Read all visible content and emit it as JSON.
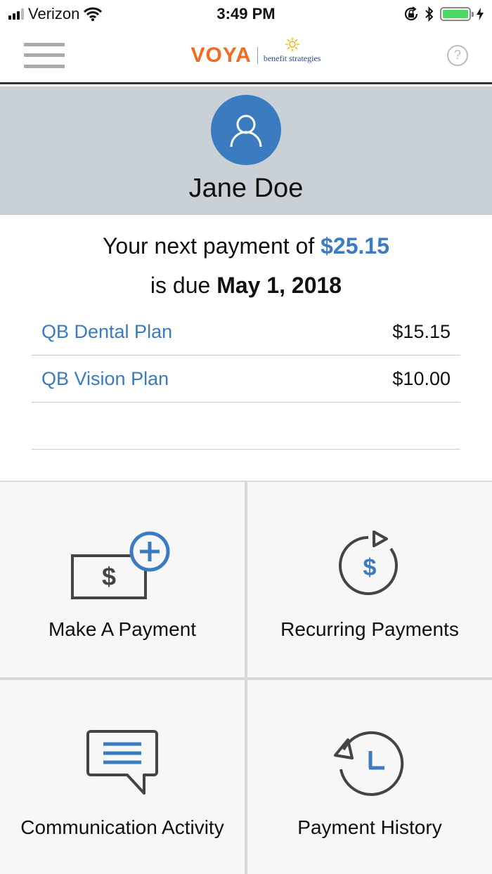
{
  "status_bar": {
    "carrier": "Verizon",
    "time": "3:49 PM"
  },
  "nav": {
    "logo_brand": "VOYA",
    "logo_partner": "benefit strategies",
    "help_symbol": "?"
  },
  "profile": {
    "name": "Jane Doe",
    "avatar_icon": "user-icon"
  },
  "payment": {
    "prefix": "Your next payment of ",
    "amount": "$25.15",
    "due_prefix": "is due ",
    "due_date": "May 1, 2018",
    "plans": [
      {
        "name": "QB Dental Plan",
        "amount": "$15.15"
      },
      {
        "name": "QB Vision Plan",
        "amount": "$10.00"
      }
    ]
  },
  "tiles": [
    {
      "label": "Make A Payment",
      "icon": "add-payment-icon"
    },
    {
      "label": "Recurring Payments",
      "icon": "recurring-payment-icon"
    },
    {
      "label": "Communication Activity",
      "icon": "message-icon"
    },
    {
      "label": "Payment History",
      "icon": "history-icon"
    }
  ],
  "colors": {
    "accent": "#3b7bbf",
    "brand_orange": "#f26b21",
    "profile_band": "#c9d0d6",
    "battery": "#4cd964"
  }
}
